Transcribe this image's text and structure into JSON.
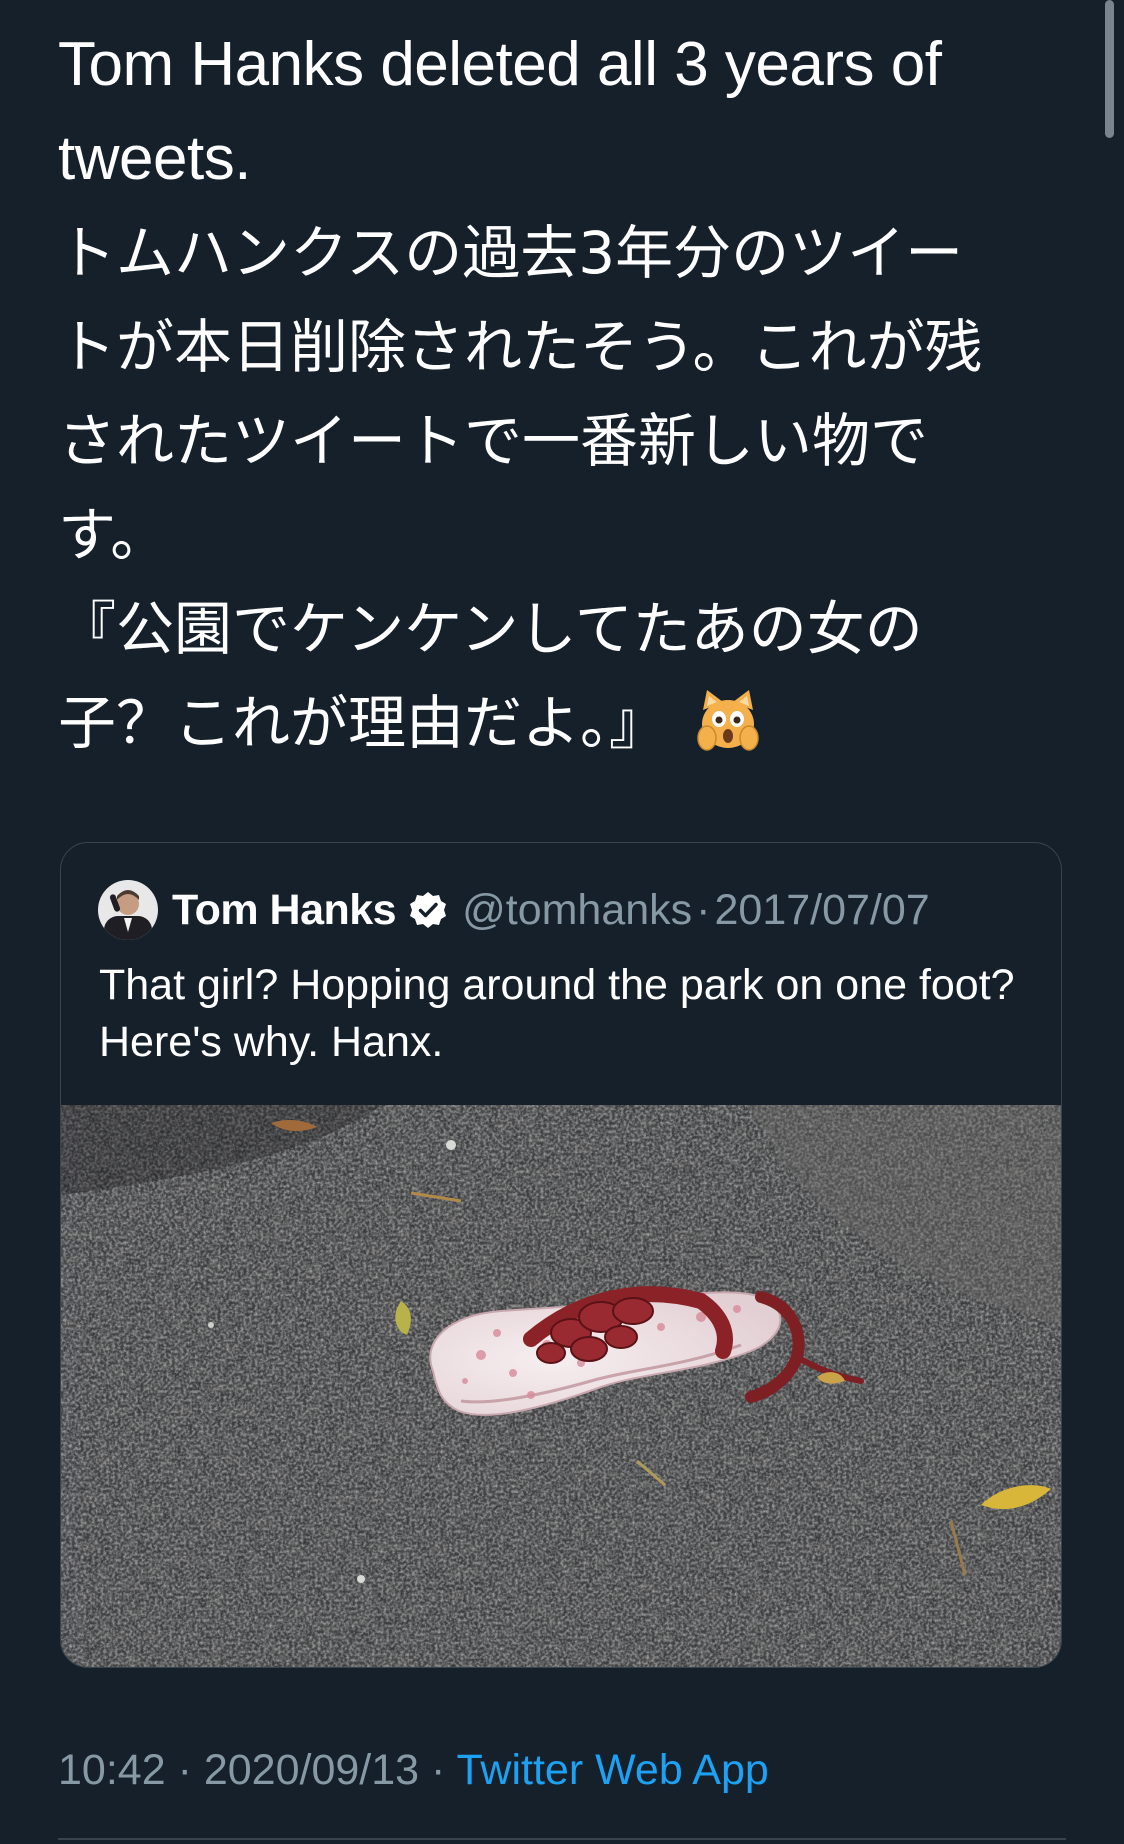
{
  "tweet": {
    "text_lines": [
      "Tom Hanks deleted all 3 years of",
      "tweets.",
      "トムハンクスの過去3年分のツイー",
      "トが本日削除されたそう。これが残",
      "されたツイートで一番新しい物で",
      "す。",
      "『公園でケンケンしてたあの女の",
      "子？これが理由だよ。』"
    ],
    "emoji": "scream-cat-emoji",
    "time": "10:42",
    "date": "2020/09/13",
    "separator": "·",
    "source": "Twitter Web App"
  },
  "quoted_tweet": {
    "author_name": "Tom Hanks",
    "verified_icon": "verified-badge-icon",
    "handle": "@tomhanks",
    "separator": "·",
    "date": "2017/07/07",
    "text": "That girl? Hopping around the park on one foot? Here's why. Hanx.",
    "media": "photo-red-sandal-on-asphalt"
  },
  "colors": {
    "background": "#15202b",
    "border": "#38444d",
    "secondary_text": "#8899a6",
    "link": "#1da1f2",
    "primary_text": "#ffffff"
  }
}
